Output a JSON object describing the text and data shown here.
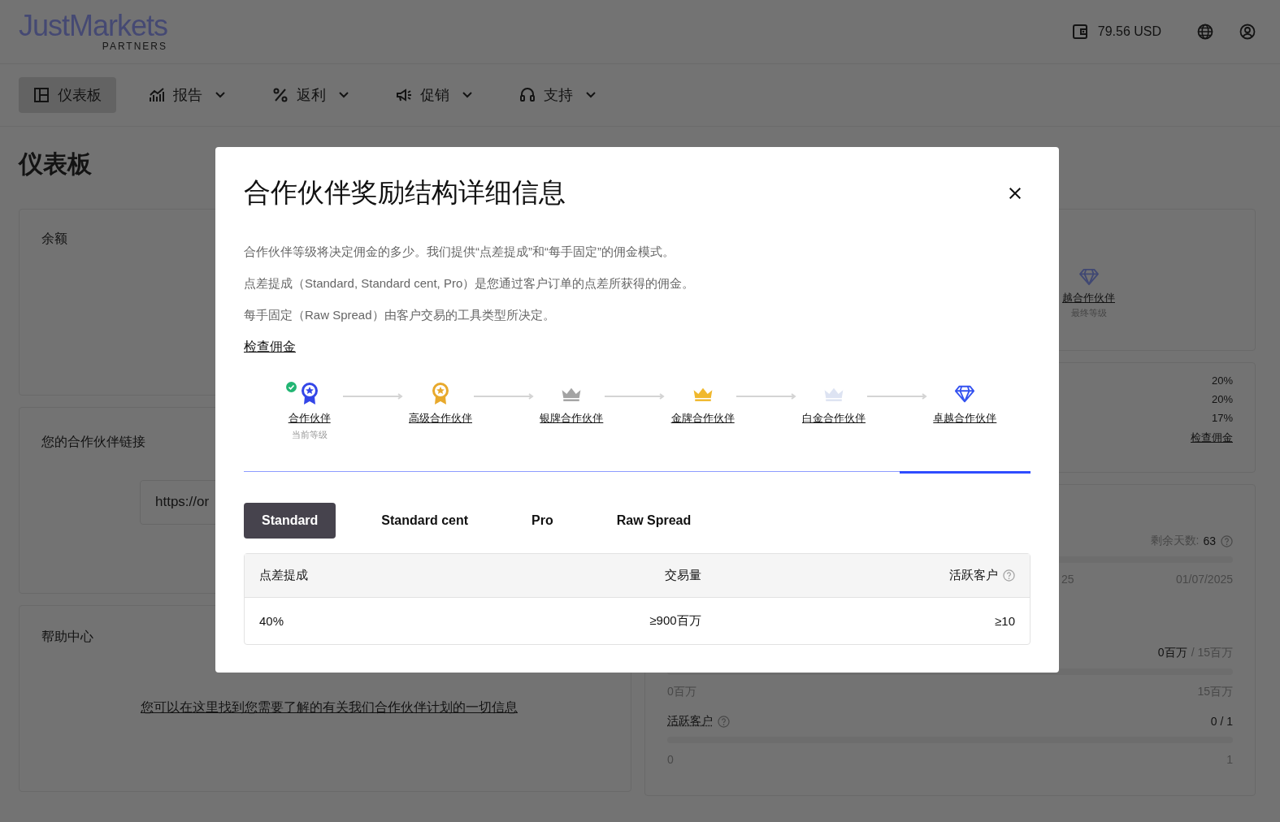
{
  "header": {
    "logo": "JustMarkets",
    "logo_sub": "PARTNERS",
    "balance": "79.56 USD"
  },
  "nav": [
    {
      "label": "仪表板",
      "kind": "dashboard",
      "selected": true,
      "menu": false
    },
    {
      "label": "报告",
      "kind": "reports",
      "selected": false,
      "menu": true
    },
    {
      "label": "返利",
      "kind": "rebates",
      "selected": false,
      "menu": true
    },
    {
      "label": "促销",
      "kind": "promo",
      "selected": false,
      "menu": true
    },
    {
      "label": "支持",
      "kind": "support",
      "selected": false,
      "menu": true
    }
  ],
  "page_title": "仪表板",
  "balance_card": {
    "title": "余额"
  },
  "link_card": {
    "title": "您的合作伙伴链接",
    "link_value": "https://or"
  },
  "help_card": {
    "title": "帮助中心",
    "link": "您可以在这里找到您需要了解的有关我们合作伙伴计划的一切信息"
  },
  "tier_card": {
    "tier_name": "越合作伙伴",
    "tier_note": "最终等级"
  },
  "rates_card": {
    "rates": [
      "20%",
      "20%",
      "17%"
    ],
    "link": "检查佣金"
  },
  "progress_card": {
    "days_left_label": "剩余天数:",
    "days_left": "63",
    "period_track": {
      "level": 0
    },
    "period_start": "25",
    "period_end": "01/07/2025",
    "volume_value": "0百万",
    "volume_target": "/ 15百万",
    "volume_track": {
      "level": 0
    },
    "volume_min": "0百万",
    "volume_max": "15百万",
    "clients_label": "活跃客户",
    "clients_value": "0 / 1",
    "clients_track": {
      "level": 0
    },
    "clients_min": "0",
    "clients_max": "1"
  },
  "modal": {
    "title": "合作伙伴奖励结构详细信息",
    "paragraphs": [
      "合作伙伴等级将决定佣金的多少。我们提供“点差提成”和“每手固定”的佣金模式。",
      "点差提成（Standard, Standard cent, Pro）是您通过客户订单的点差所获得的佣金。",
      "每手固定（Raw Spread）由客户交易的工具类型所决定。"
    ],
    "link": "检查佣金",
    "tiers": [
      {
        "name": "合作伙伴",
        "kind": "medal",
        "color": "#3346e8",
        "current": true,
        "note": "当前等级",
        "selected": false
      },
      {
        "name": "高级合作伙伴",
        "kind": "medal",
        "color": "#e8a92c",
        "current": false,
        "selected": false
      },
      {
        "name": "银牌合作伙伴",
        "kind": "crown",
        "color": "#a3a3a3",
        "current": false,
        "selected": false
      },
      {
        "name": "金牌合作伙伴",
        "kind": "crown",
        "color": "#f0b82d",
        "current": false,
        "selected": false
      },
      {
        "name": "白金合作伙伴",
        "kind": "crown",
        "color": "#dde3f2",
        "current": false,
        "selected": false
      },
      {
        "name": "卓越合作伙伴",
        "kind": "diamond",
        "color": "#3452f0",
        "current": false,
        "selected": true
      }
    ],
    "tabs": [
      {
        "label": "Standard",
        "selected": true
      },
      {
        "label": "Standard cent",
        "selected": false
      },
      {
        "label": "Pro",
        "selected": false
      },
      {
        "label": "Raw Spread",
        "selected": false
      }
    ],
    "table": {
      "columns": [
        {
          "label": "点差提成",
          "help": false
        },
        {
          "label": "交易量",
          "help": false
        },
        {
          "label": "活跃客户",
          "help": true
        }
      ],
      "rows": [
        [
          "40%",
          "≥900百万",
          "≥10"
        ]
      ]
    }
  }
}
